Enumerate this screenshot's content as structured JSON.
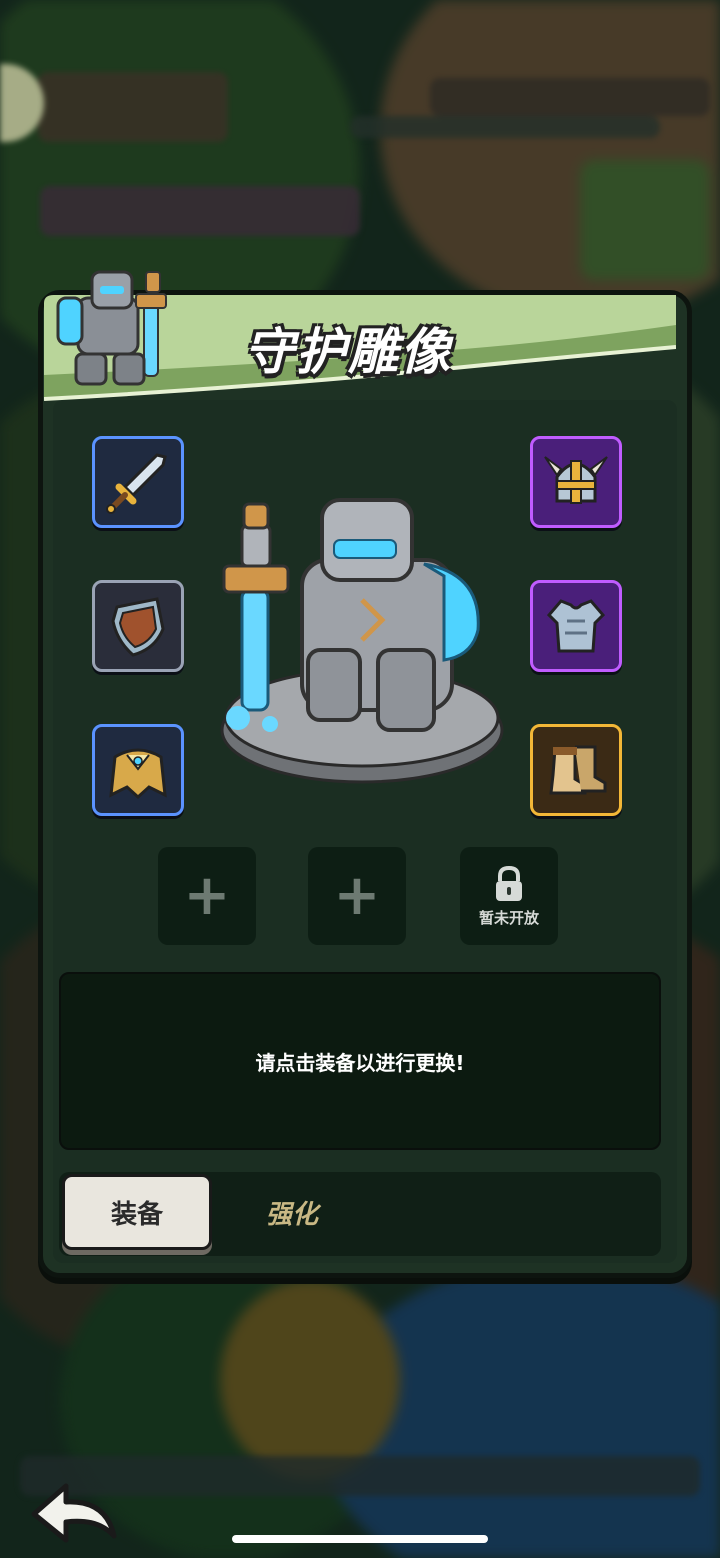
{
  "title": "守护雕像",
  "equipment_slots": [
    {
      "icon": "sword-icon",
      "rarity_color": "#5b93ff",
      "side": "left"
    },
    {
      "icon": "shield-icon",
      "rarity_color": "#9aa3b5",
      "side": "left"
    },
    {
      "icon": "cape-icon",
      "rarity_color": "#5b93ff",
      "side": "left"
    },
    {
      "icon": "horned-helmet-icon",
      "rarity_color": "#c05cff",
      "side": "right"
    },
    {
      "icon": "armor-icon",
      "rarity_color": "#c05cff",
      "side": "right"
    },
    {
      "icon": "boots-icon",
      "rarity_color": "#f3b737",
      "side": "right"
    }
  ],
  "extra_slots": [
    {
      "type": "add",
      "symbol": "+"
    },
    {
      "type": "add",
      "symbol": "+"
    },
    {
      "type": "locked",
      "label": "暂未开放"
    }
  ],
  "info": {
    "message": "请点击装备以进行更换!"
  },
  "tabs": {
    "active": "装备",
    "inactive": "强化"
  },
  "colors": {
    "banner_green": "#b9d59a",
    "panel_dark": "#1e3224",
    "accent_cyan": "#4fd3ff"
  }
}
